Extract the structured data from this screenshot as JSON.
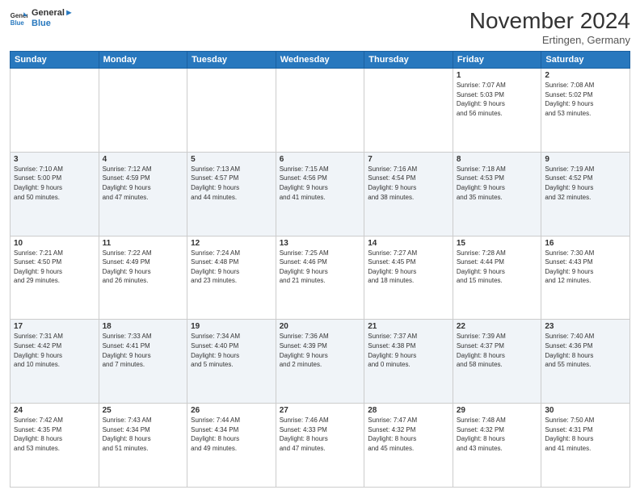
{
  "header": {
    "logo_line1": "General",
    "logo_line2": "Blue",
    "month": "November 2024",
    "location": "Ertingen, Germany"
  },
  "weekdays": [
    "Sunday",
    "Monday",
    "Tuesday",
    "Wednesday",
    "Thursday",
    "Friday",
    "Saturday"
  ],
  "weeks": [
    [
      {
        "day": "",
        "info": ""
      },
      {
        "day": "",
        "info": ""
      },
      {
        "day": "",
        "info": ""
      },
      {
        "day": "",
        "info": ""
      },
      {
        "day": "",
        "info": ""
      },
      {
        "day": "1",
        "info": "Sunrise: 7:07 AM\nSunset: 5:03 PM\nDaylight: 9 hours\nand 56 minutes."
      },
      {
        "day": "2",
        "info": "Sunrise: 7:08 AM\nSunset: 5:02 PM\nDaylight: 9 hours\nand 53 minutes."
      }
    ],
    [
      {
        "day": "3",
        "info": "Sunrise: 7:10 AM\nSunset: 5:00 PM\nDaylight: 9 hours\nand 50 minutes."
      },
      {
        "day": "4",
        "info": "Sunrise: 7:12 AM\nSunset: 4:59 PM\nDaylight: 9 hours\nand 47 minutes."
      },
      {
        "day": "5",
        "info": "Sunrise: 7:13 AM\nSunset: 4:57 PM\nDaylight: 9 hours\nand 44 minutes."
      },
      {
        "day": "6",
        "info": "Sunrise: 7:15 AM\nSunset: 4:56 PM\nDaylight: 9 hours\nand 41 minutes."
      },
      {
        "day": "7",
        "info": "Sunrise: 7:16 AM\nSunset: 4:54 PM\nDaylight: 9 hours\nand 38 minutes."
      },
      {
        "day": "8",
        "info": "Sunrise: 7:18 AM\nSunset: 4:53 PM\nDaylight: 9 hours\nand 35 minutes."
      },
      {
        "day": "9",
        "info": "Sunrise: 7:19 AM\nSunset: 4:52 PM\nDaylight: 9 hours\nand 32 minutes."
      }
    ],
    [
      {
        "day": "10",
        "info": "Sunrise: 7:21 AM\nSunset: 4:50 PM\nDaylight: 9 hours\nand 29 minutes."
      },
      {
        "day": "11",
        "info": "Sunrise: 7:22 AM\nSunset: 4:49 PM\nDaylight: 9 hours\nand 26 minutes."
      },
      {
        "day": "12",
        "info": "Sunrise: 7:24 AM\nSunset: 4:48 PM\nDaylight: 9 hours\nand 23 minutes."
      },
      {
        "day": "13",
        "info": "Sunrise: 7:25 AM\nSunset: 4:46 PM\nDaylight: 9 hours\nand 21 minutes."
      },
      {
        "day": "14",
        "info": "Sunrise: 7:27 AM\nSunset: 4:45 PM\nDaylight: 9 hours\nand 18 minutes."
      },
      {
        "day": "15",
        "info": "Sunrise: 7:28 AM\nSunset: 4:44 PM\nDaylight: 9 hours\nand 15 minutes."
      },
      {
        "day": "16",
        "info": "Sunrise: 7:30 AM\nSunset: 4:43 PM\nDaylight: 9 hours\nand 12 minutes."
      }
    ],
    [
      {
        "day": "17",
        "info": "Sunrise: 7:31 AM\nSunset: 4:42 PM\nDaylight: 9 hours\nand 10 minutes."
      },
      {
        "day": "18",
        "info": "Sunrise: 7:33 AM\nSunset: 4:41 PM\nDaylight: 9 hours\nand 7 minutes."
      },
      {
        "day": "19",
        "info": "Sunrise: 7:34 AM\nSunset: 4:40 PM\nDaylight: 9 hours\nand 5 minutes."
      },
      {
        "day": "20",
        "info": "Sunrise: 7:36 AM\nSunset: 4:39 PM\nDaylight: 9 hours\nand 2 minutes."
      },
      {
        "day": "21",
        "info": "Sunrise: 7:37 AM\nSunset: 4:38 PM\nDaylight: 9 hours\nand 0 minutes."
      },
      {
        "day": "22",
        "info": "Sunrise: 7:39 AM\nSunset: 4:37 PM\nDaylight: 8 hours\nand 58 minutes."
      },
      {
        "day": "23",
        "info": "Sunrise: 7:40 AM\nSunset: 4:36 PM\nDaylight: 8 hours\nand 55 minutes."
      }
    ],
    [
      {
        "day": "24",
        "info": "Sunrise: 7:42 AM\nSunset: 4:35 PM\nDaylight: 8 hours\nand 53 minutes."
      },
      {
        "day": "25",
        "info": "Sunrise: 7:43 AM\nSunset: 4:34 PM\nDaylight: 8 hours\nand 51 minutes."
      },
      {
        "day": "26",
        "info": "Sunrise: 7:44 AM\nSunset: 4:34 PM\nDaylight: 8 hours\nand 49 minutes."
      },
      {
        "day": "27",
        "info": "Sunrise: 7:46 AM\nSunset: 4:33 PM\nDaylight: 8 hours\nand 47 minutes."
      },
      {
        "day": "28",
        "info": "Sunrise: 7:47 AM\nSunset: 4:32 PM\nDaylight: 8 hours\nand 45 minutes."
      },
      {
        "day": "29",
        "info": "Sunrise: 7:48 AM\nSunset: 4:32 PM\nDaylight: 8 hours\nand 43 minutes."
      },
      {
        "day": "30",
        "info": "Sunrise: 7:50 AM\nSunset: 4:31 PM\nDaylight: 8 hours\nand 41 minutes."
      }
    ]
  ]
}
